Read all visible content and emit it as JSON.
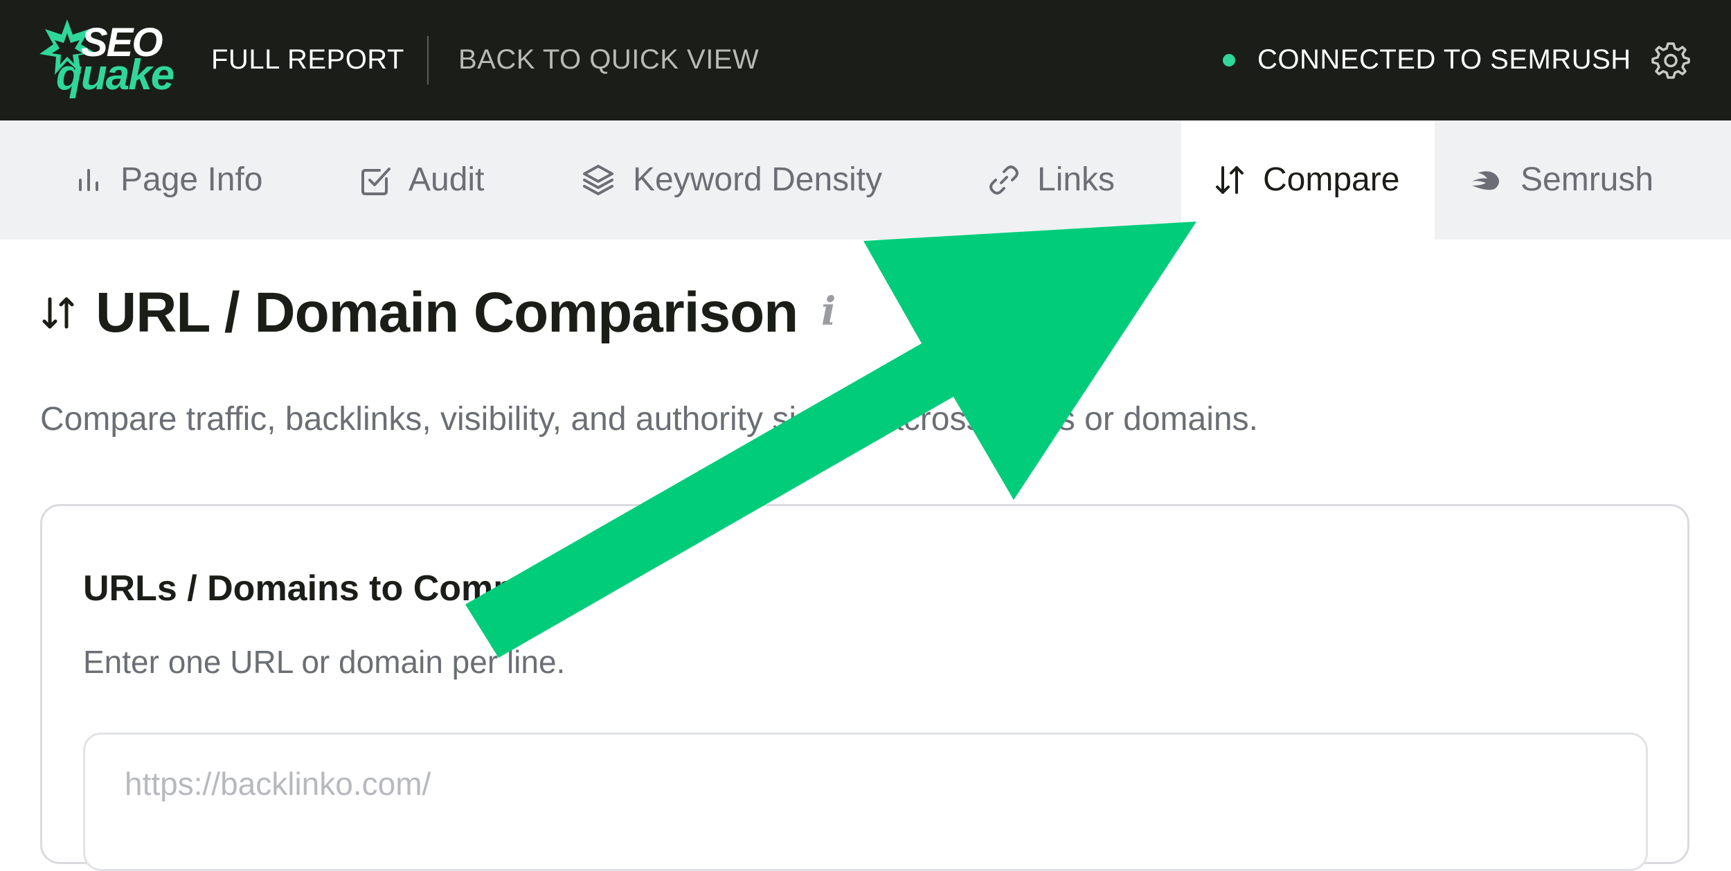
{
  "topbar": {
    "logo": {
      "line1": "SEO",
      "line2": "quake"
    },
    "full_report": "FULL REPORT",
    "back_to_quick_view": "BACK TO QUICK VIEW",
    "status": "CONNECTED TO SEMRUSH",
    "status_color": "#2fd89a",
    "settings_icon": "gear-icon"
  },
  "tabs": [
    {
      "label": "Page Info",
      "icon": "bar-chart-icon",
      "active": false
    },
    {
      "label": "Audit",
      "icon": "checkbox-icon",
      "active": false
    },
    {
      "label": "Keyword Density",
      "icon": "layers-icon",
      "active": false
    },
    {
      "label": "Links",
      "icon": "link-icon",
      "active": false
    },
    {
      "label": "Compare",
      "icon": "sort-arrows-icon",
      "active": true
    },
    {
      "label": "Semrush",
      "icon": "semrush-icon",
      "active": false
    }
  ],
  "main": {
    "title": "URL / Domain Comparison",
    "info_icon": "i",
    "description": "Compare traffic, backlinks, visibility, and authority signals across URLs or domains.",
    "card": {
      "title": "URLs / Domains to Compare",
      "hint": "Enter one URL or domain per line.",
      "placeholder": "https://backlinko.com/"
    }
  },
  "annotation": {
    "arrow_color": "#00cc7a"
  },
  "colors": {
    "topbar_bg": "#1b1d18",
    "tabbar_bg": "#f0f1f2",
    "accent": "#2fd89a"
  }
}
